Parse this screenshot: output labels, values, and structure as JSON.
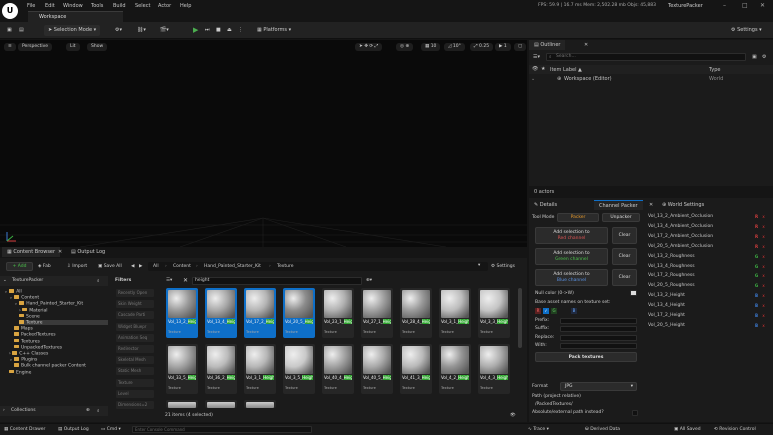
{
  "title_bar": {
    "menus": [
      "File",
      "Edit",
      "Window",
      "Tools",
      "Build",
      "Select",
      "Actor",
      "Help"
    ],
    "tab": "Workspace",
    "stats": "FPS: 59.9  |  16.7 ms  Mem: 2,502.28 mb  Objs: 45,883",
    "window_title": "TexturePacker"
  },
  "toolbar": {
    "mode": "Selection Mode",
    "platforms": "Platforms",
    "settings": "Settings"
  },
  "viewport": {
    "perspective": "Perspective",
    "lit": "Lit",
    "show": "Show",
    "grid_snap": "10",
    "rot_snap": "10°",
    "scale_snap": "0.25",
    "cam_speed": "1"
  },
  "outliner": {
    "tab": "Outliner",
    "search_placeholder": "Search...",
    "col_label": "Item Label ▲",
    "col_type": "Type",
    "row_label": "Workspace (Editor)",
    "row_type": "World",
    "actors": "0 actors"
  },
  "right_tabs": {
    "details": "Details",
    "channel_packer": "Channel Packer",
    "world_settings": "World Settings"
  },
  "packer": {
    "tool_mode": "Tool Mode",
    "packer_btn": "Packer",
    "unpacker_btn": "Unpacker",
    "add_red_1": "Add selection to",
    "add_red_2": "Red channel",
    "add_green_1": "Add selection to",
    "add_green_2": "Green channel",
    "add_blue_1": "Add selection to",
    "add_blue_2": "Blue channel",
    "clear": "Clear",
    "null_color": "Null color (0->W)",
    "base_names": "Base asset names on texture set:",
    "channels": [
      "R",
      "G",
      "B"
    ],
    "prefix": "Prefix:",
    "suffix": "Suffix:",
    "replace": "Replace:",
    "with": "With:",
    "pack_textures": "Pack textures",
    "format_label": "Format",
    "format_value": "JPG",
    "path_label": "Path (project relative)",
    "path_value": "/PackedTextures/",
    "abs_label": "Absolute/external path instead?",
    "list": [
      {
        "name": "Vol_13_2_Ambient_Occlusion",
        "ch": "R"
      },
      {
        "name": "Vol_13_4_Ambient_Occlusion",
        "ch": "R"
      },
      {
        "name": "Vol_17_2_Ambient_Occlusion",
        "ch": "R"
      },
      {
        "name": "Vol_20_5_Ambient_Occlusion",
        "ch": "R"
      },
      {
        "name": "Vol_13_2_Roughness",
        "ch": "G"
      },
      {
        "name": "Vol_13_4_Roughness",
        "ch": "G"
      },
      {
        "name": "Vol_17_2_Roughness",
        "ch": "G"
      },
      {
        "name": "Vol_20_5_Roughness",
        "ch": "G"
      },
      {
        "name": "Vol_13_2_Height",
        "ch": "B"
      },
      {
        "name": "Vol_13_4_Height",
        "ch": "B"
      },
      {
        "name": "Vol_17_2_Height",
        "ch": "B"
      },
      {
        "name": "Vol_20_5_Height",
        "ch": "B"
      }
    ],
    "remove": "x"
  },
  "content_browser": {
    "tab1": "Content Browser",
    "tab2": "Output Log",
    "add": "+ Add",
    "fab": "Fab",
    "import": "Import",
    "save_all": "Save All",
    "breadcrumb": [
      "All",
      "Content",
      "Hand_Painted_Starter_Kit",
      "Texture"
    ],
    "settings": "Settings",
    "source_title": "TexturePacker",
    "tree": [
      "All",
      "Content",
      "Hand_Painted_Starter_Kit",
      "Material",
      "Scene",
      "Texture",
      "Maps",
      "PackedTextures",
      "Textures",
      "UnpackedTextures",
      "C++ Classes",
      "Plugins",
      "Bulk channel packer Content",
      "Engine"
    ],
    "collections": "Collections",
    "filters_label": "Filters",
    "filters": [
      "Recently Open",
      "Skin Weight",
      "Cascade Parti",
      "Widget Bluepr",
      "Animation Seq",
      "Redirector",
      "Skeletal Mesh",
      "Static Mesh",
      "Texture",
      "Level",
      "Dimensions=2"
    ],
    "search_value": "height",
    "item_count": "21 items (4 selected)",
    "asset_type": "Texture",
    "assets_row1": [
      {
        "name": "Vol_13_2_Height",
        "sel": true,
        "tone": "#9a9a9a"
      },
      {
        "name": "Vol_13_4_Height",
        "sel": true,
        "tone": "#a8a8a8"
      },
      {
        "name": "Vol_17_2_Height",
        "sel": true,
        "tone": "#b4b4b4"
      },
      {
        "name": "Vol_20_5_Height",
        "sel": true,
        "tone": "#8c8c8c"
      },
      {
        "name": "Vol_23_1_Height",
        "sel": false,
        "tone": "#b0b0b0"
      },
      {
        "name": "Vol_27_1_Height",
        "sel": false,
        "tone": "#a0a0a0"
      },
      {
        "name": "Vol_28_4_Height",
        "sel": false,
        "tone": "#999"
      },
      {
        "name": "Vol_3_1_Height",
        "sel": false,
        "tone": "#bcbcbc"
      },
      {
        "name": "Vol_3_3_Height",
        "sel": false,
        "tone": "#c4c4c4"
      }
    ],
    "assets_row2": [
      {
        "name": "Vol_33_5_Height",
        "sel": false,
        "tone": "#a5a5a5"
      },
      {
        "name": "Vol_36_2_Height",
        "sel": false,
        "tone": "#bbbbbb"
      },
      {
        "name": "Vol_3_1_Height",
        "sel": false,
        "tone": "#b7b7b7"
      },
      {
        "name": "Vol_3_5_Height",
        "sel": false,
        "tone": "#c9c9c9"
      },
      {
        "name": "Vol_40_4_Height",
        "sel": false,
        "tone": "#a2a2a2"
      },
      {
        "name": "Vol_40_5_Height",
        "sel": false,
        "tone": "#aaaaaa"
      },
      {
        "name": "Vol_41_3_Height",
        "sel": false,
        "tone": "#b9b9b9"
      },
      {
        "name": "Vol_4_2_Height",
        "sel": false,
        "tone": "#959595"
      },
      {
        "name": "Vol_4_3_Height",
        "sel": false,
        "tone": "#adadad"
      }
    ]
  },
  "status_bar": {
    "content_drawer": "Content Drawer",
    "output_log": "Output Log",
    "cmd": "Cmd",
    "cmd_placeholder": "Enter Console Command",
    "trace": "Trace",
    "derived_data": "Derived Data",
    "all_saved": "All Saved",
    "revision": "Revision Control"
  },
  "colors": {
    "accent": "#0e6fc8",
    "packer_orange": "#e89a2b",
    "red": "#d33c3c",
    "green": "#3cb043",
    "blue": "#3c7bd3"
  }
}
